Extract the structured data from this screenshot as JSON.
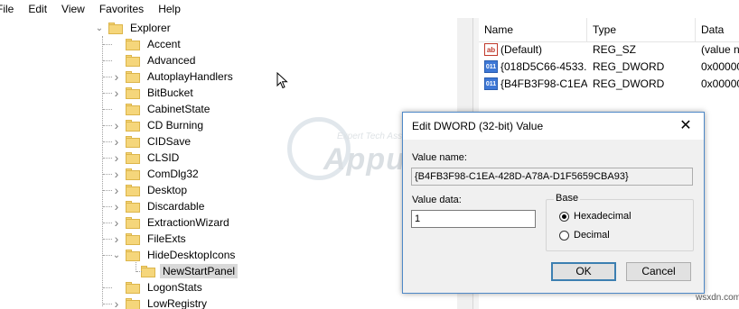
{
  "menu": [
    "File",
    "Edit",
    "View",
    "Favorites",
    "Help"
  ],
  "tree": {
    "parent": "Explorer",
    "items": [
      {
        "label": "Accent",
        "expandable": false
      },
      {
        "label": "Advanced",
        "expandable": false
      },
      {
        "label": "AutoplayHandlers",
        "expandable": true
      },
      {
        "label": "BitBucket",
        "expandable": true
      },
      {
        "label": "CabinetState",
        "expandable": false
      },
      {
        "label": "CD Burning",
        "expandable": true
      },
      {
        "label": "CIDSave",
        "expandable": true
      },
      {
        "label": "CLSID",
        "expandable": true
      },
      {
        "label": "ComDlg32",
        "expandable": true
      },
      {
        "label": "Desktop",
        "expandable": true
      },
      {
        "label": "Discardable",
        "expandable": true
      },
      {
        "label": "ExtractionWizard",
        "expandable": true
      },
      {
        "label": "FileExts",
        "expandable": true
      },
      {
        "label": "HideDesktopIcons",
        "expandable": true,
        "expanded": true
      },
      {
        "label": "NewStartPanel",
        "expandable": false,
        "child": true,
        "selected": true
      },
      {
        "label": "LogonStats",
        "expandable": false
      },
      {
        "label": "LowRegistry",
        "expandable": true
      }
    ]
  },
  "list": {
    "columns": [
      "Name",
      "Type",
      "Data"
    ],
    "rows": [
      {
        "icon": "ab",
        "name": "(Default)",
        "type": "REG_SZ",
        "data": "(value n"
      },
      {
        "icon": "011",
        "name": "{018D5C66-4533...",
        "type": "REG_DWORD",
        "data": "0x00000"
      },
      {
        "icon": "011",
        "name": "{B4FB3F98-C1EA...",
        "type": "REG_DWORD",
        "data": "0x00000"
      }
    ]
  },
  "dialog": {
    "title": "Edit DWORD (32-bit) Value",
    "value_name_label": "Value name:",
    "value_name": "{B4FB3F98-C1EA-428D-A78A-D1F5659CBA93}",
    "value_data_label": "Value data:",
    "value_data": "1",
    "base_label": "Base",
    "base_options": [
      "Hexadecimal",
      "Decimal"
    ],
    "base_selected": "Hexadecimal",
    "ok_label": "OK",
    "cancel_label": "Cancel"
  },
  "watermark": {
    "tagline": "Expert Tech Assistance!",
    "brand": "Appuals"
  },
  "credit": "wsxdn.com"
}
